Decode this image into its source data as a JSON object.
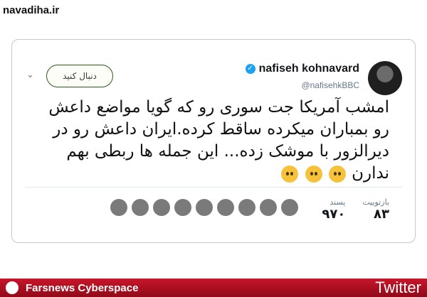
{
  "watermark": "navadiha.ir",
  "tweet": {
    "display_name": "nafiseh kohnavard",
    "handle": "@nafisehkBBC",
    "follow_label": "دنبال کنید",
    "text": "امشب آمریکا جت سوری رو که گویا مواضع داعش رو بمباران میکرده ساقط کرده.ایران داعش رو در دیرالزور با موشک زده... این جمله ها ربطی بهم ندارن",
    "stats": {
      "retweets_label": "بازتوییت",
      "retweets_value": "۸۳",
      "likes_label": "پسند",
      "likes_value": "۹۷۰"
    }
  },
  "footer": {
    "left_label": "Farsnews Cyberspace",
    "right_label": "Twitter"
  },
  "colors": {
    "verified": "#1da1f2",
    "footer_bg": "#c8152a"
  }
}
